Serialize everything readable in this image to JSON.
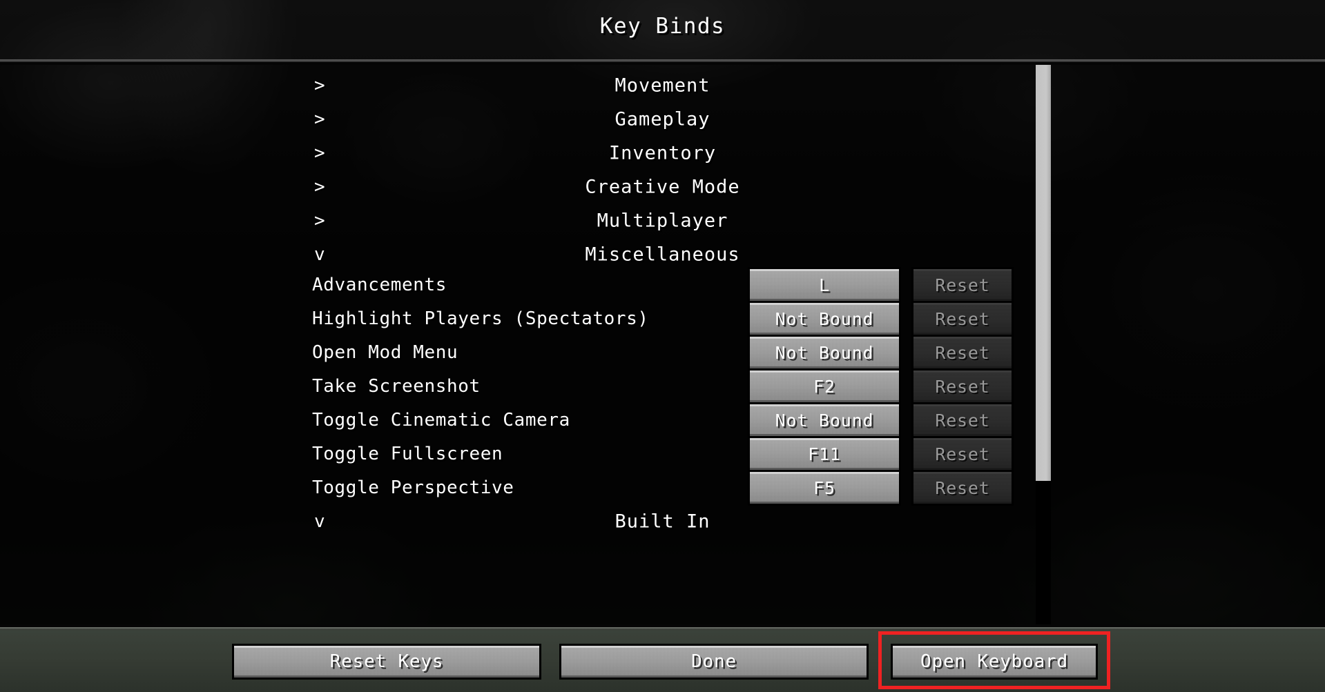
{
  "header": {
    "title": "Key Binds"
  },
  "categories": [
    {
      "arrow": "chevron-right-icon",
      "glyph": ">",
      "label": "Movement",
      "expanded": false
    },
    {
      "arrow": "chevron-right-icon",
      "glyph": ">",
      "label": "Gameplay",
      "expanded": false
    },
    {
      "arrow": "chevron-right-icon",
      "glyph": ">",
      "label": "Inventory",
      "expanded": false
    },
    {
      "arrow": "chevron-right-icon",
      "glyph": ">",
      "label": "Creative Mode",
      "expanded": false
    },
    {
      "arrow": "chevron-right-icon",
      "glyph": ">",
      "label": "Multiplayer",
      "expanded": false
    },
    {
      "arrow": "chevron-down-icon",
      "glyph": "v",
      "label": "Miscellaneous",
      "expanded": true
    }
  ],
  "keybinds": [
    {
      "name": "Advancements",
      "key": "L",
      "reset_label": "Reset",
      "reset_enabled": false
    },
    {
      "name": "Highlight Players (Spectators)",
      "key": "Not Bound",
      "reset_label": "Reset",
      "reset_enabled": false
    },
    {
      "name": "Open Mod Menu",
      "key": "Not Bound",
      "reset_label": "Reset",
      "reset_enabled": false
    },
    {
      "name": "Take Screenshot",
      "key": "F2",
      "reset_label": "Reset",
      "reset_enabled": false
    },
    {
      "name": "Toggle Cinematic Camera",
      "key": "Not Bound",
      "reset_label": "Reset",
      "reset_enabled": false
    },
    {
      "name": "Toggle Fullscreen",
      "key": "F11",
      "reset_label": "Reset",
      "reset_enabled": false
    },
    {
      "name": "Toggle Perspective",
      "key": "F5",
      "reset_label": "Reset",
      "reset_enabled": false
    }
  ],
  "clipped_row": {
    "arrow": "chevron-down-icon",
    "glyph": "v",
    "label": "Built In"
  },
  "footer": {
    "reset_keys_label": "Reset Keys",
    "done_label": "Done",
    "open_keyboard_label": "Open Keyboard"
  },
  "highlight": {
    "target": "open-keyboard-button",
    "color": "#ef2222"
  },
  "scrollbar": {
    "thumb_color": "#c2c2c2",
    "track_color": "#000000"
  }
}
